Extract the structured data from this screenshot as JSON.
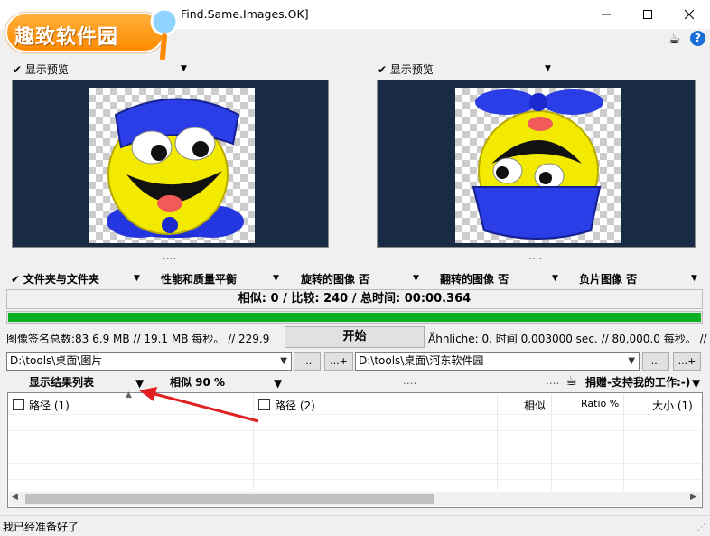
{
  "window": {
    "title": "Find.Same.Images.OK]",
    "watermark": "趣致软件园",
    "minimize": "—",
    "maximize": "☐",
    "close": "✕",
    "coffee_icon": "☕",
    "help_icon": "?"
  },
  "preview": {
    "left_label": "显示预览",
    "right_label": "显示预览",
    "left_dots": "....",
    "right_dots": "....",
    "background": "#192a44"
  },
  "options": {
    "folder_mode": "文件夹与文件夹",
    "quality": "性能和质量平衡",
    "rotate": "旋转的图像 否",
    "flip": "翻转的图像 否",
    "negative": "负片图像 否"
  },
  "status": {
    "similarity_line": "相似: 0 / 比较: 240 / 总时间: 00:00.364",
    "progress_percent": 100,
    "progress_color": "#06b025",
    "signature_line": "图像签名总数:83   6.9 MB // 19.1 MB 每秒。 // 229.9",
    "start_button": "开始",
    "aehnliche_line": "Ähnliche: 0, 时间 0.003000 sec. // 80,000.0 每秒。 //"
  },
  "paths": {
    "left_path": "D:\\tools\\桌面\\图片",
    "right_path": "D:\\tools\\桌面\\河东软件园",
    "browse_label": "...",
    "add_label": "...+"
  },
  "results": {
    "show_list": "显示结果列表",
    "similarity": "相似 90 %",
    "middle_dots": "....",
    "right_dots": "....",
    "donate": "捐赠-支持我的工作:-)",
    "columns": [
      "路径 (1)",
      "路径 (2)",
      "相似",
      "Ratio %",
      "大小 (1)"
    ]
  },
  "statusbar": {
    "text": "我已经准备好了"
  }
}
